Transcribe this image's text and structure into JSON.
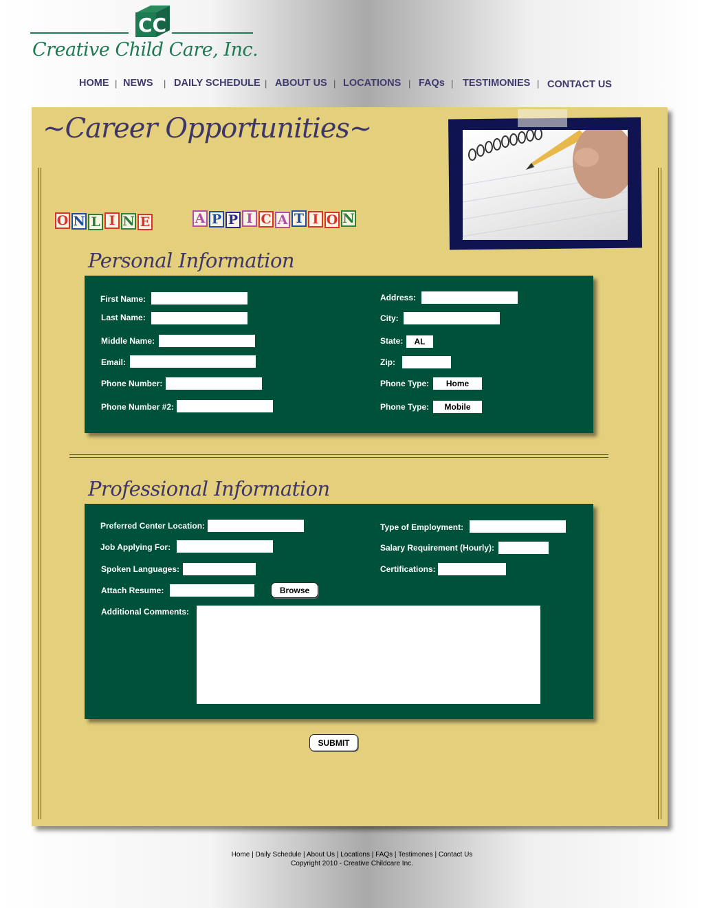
{
  "header": {
    "company_name": "Creative Child Care, Inc.",
    "logo_letters": "CC"
  },
  "nav": [
    {
      "label": "HOME"
    },
    {
      "label": "NEWS"
    },
    {
      "label": "DAILY SCHEDULE"
    },
    {
      "label": "ABOUT US"
    },
    {
      "label": "LOCATIONS"
    },
    {
      "label": "FAQs"
    },
    {
      "label": "TESTIMONIES"
    },
    {
      "label": "CONTACT US"
    }
  ],
  "nav_separator": "|",
  "main": {
    "title": "~Career Opportunities~",
    "banner_word1": [
      "O",
      "N",
      "L",
      "I",
      "N",
      "E"
    ],
    "banner_word2": [
      "A",
      "P",
      "P",
      "I",
      "C",
      "A",
      "T",
      "I",
      "O",
      "N"
    ],
    "banner_word1_colors": [
      "#d9342b",
      "#1f4fa3",
      "#2e7d3a",
      "#d9342b",
      "#2e7d3a",
      "#d9342b"
    ],
    "banner_word2_colors": [
      "#b24ea8",
      "#1f4fa3",
      "#2a2a8a",
      "#b24ea8",
      "#d9342b",
      "#b24ea8",
      "#1f4fa3",
      "#d9342b",
      "#d9342b",
      "#2e7d3a"
    ],
    "personal": {
      "title": "Personal Information",
      "first_name": "First Name:",
      "last_name": "Last Name:",
      "middle_name": "Middle Name:",
      "email": "Email:",
      "phone": "Phone Number:",
      "phone2": "Phone Number #2:",
      "address": "Address:",
      "city": "City:",
      "state": "State:",
      "state_value": "AL",
      "zip": "Zip:",
      "phone_type": "Phone Type:",
      "phone_type_value": "Home",
      "phone_type2": "Phone Type:",
      "phone_type2_value": "Mobile"
    },
    "professional": {
      "title": "Professional Information",
      "center_location": "Preferred Center Location:",
      "job_applying": "Job Applying For:",
      "languages": "Spoken Languages:",
      "resume": "Attach Resume:",
      "browse": "Browse",
      "comments": "Additional Comments:",
      "employment_type": "Type of Employment:",
      "salary": "Salary Requirement (Hourly):",
      "certifications": "Certifications:"
    },
    "submit": "SUBMIT"
  },
  "footer": {
    "links": [
      "Home",
      "Daily Schedule",
      "About Us",
      "Locations",
      "FAQs",
      "Testimones",
      "Contact Us"
    ],
    "separator": " | ",
    "copyright": "Copyright 2010 - Creative Childcare Inc."
  },
  "colors": {
    "brand_green": "#1e7a52",
    "form_green": "#00513a",
    "panel_tan": "#e3cf7c",
    "title_purple": "#3e3568"
  }
}
